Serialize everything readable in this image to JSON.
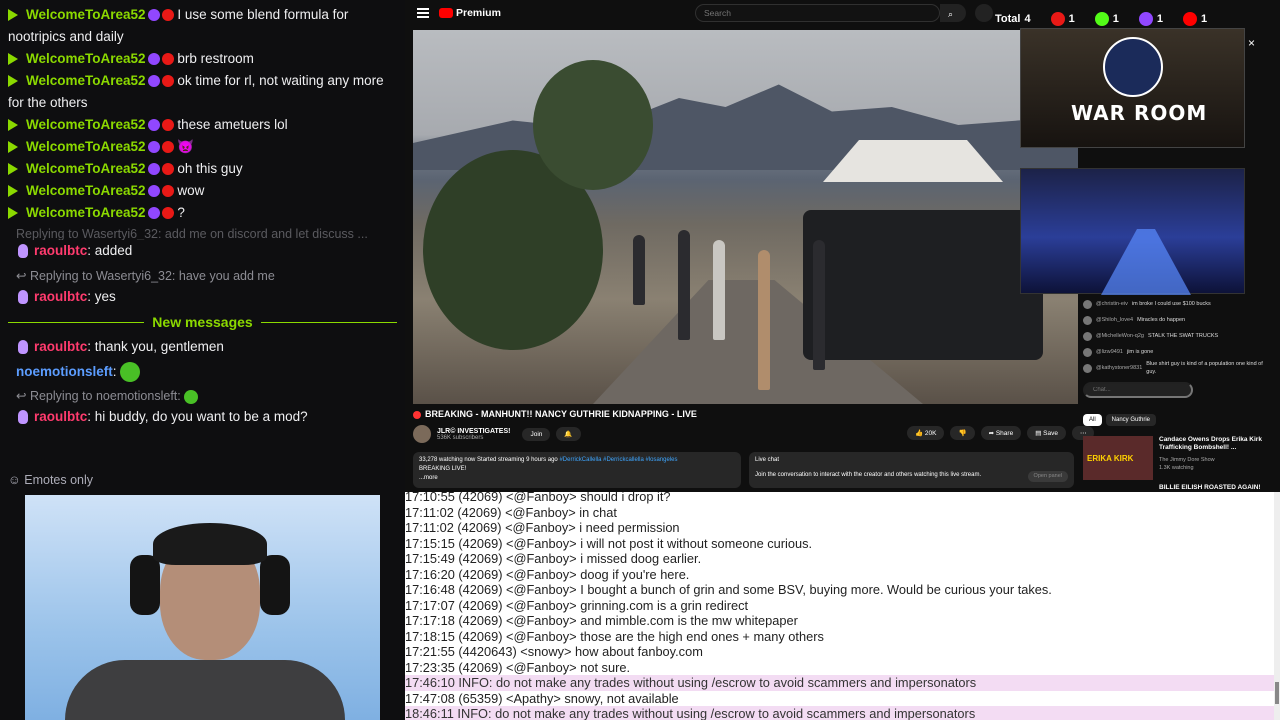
{
  "chat": {
    "messages": [
      {
        "user": "WelcomeToArea52",
        "text": "I use some blend formula for nootripics and daily"
      },
      {
        "user": "WelcomeToArea52",
        "text": "brb restroom"
      },
      {
        "user": "WelcomeToArea52",
        "text": "ok time for rl, not waiting any more for the others"
      },
      {
        "user": "WelcomeToArea52",
        "text": "these ametuers lol"
      },
      {
        "user": "WelcomeToArea52",
        "text": "👿"
      },
      {
        "user": "WelcomeToArea52",
        "text": "oh this guy"
      },
      {
        "user": "WelcomeToArea52",
        "text": "wow"
      },
      {
        "user": "WelcomeToArea52",
        "text": "?"
      }
    ],
    "reply1": "Replying to Wasertyi6_32: add me on discord and let discuss ...",
    "raoul1_user": "raoulbtc",
    "raoul1_text": ": added",
    "reply2": "Replying to Wasertyi6_32: have you add me",
    "raoul2_user": "raoulbtc",
    "raoul2_text": ": yes",
    "new_messages": "New messages",
    "raoul3_user": "raoulbtc",
    "raoul3_text": ": thank you, gentlemen",
    "noe_user": "noemotionsleft",
    "noe_text": ":",
    "reply3": "Replying to noemotionsleft:",
    "raoul4_user": "raoulbtc",
    "raoul4_text": ": hi buddy, do you want to be a mod?",
    "emotes_only": "Emotes only"
  },
  "youtube": {
    "logo": "Premium",
    "search_placeholder": "Search",
    "counter": {
      "total_label": "Total",
      "total_value": "4",
      "items": [
        {
          "value": "1",
          "color": "#e91916"
        },
        {
          "value": "1",
          "color": "#53fc18"
        },
        {
          "value": "1",
          "color": "#9147ff"
        },
        {
          "value": "1",
          "color": "#ff0000"
        }
      ]
    },
    "video_title": "BREAKING - MANHUNT!! NANCY GUTHRIE KIDNAPPING - LIVE",
    "channel_name": "JLR© INVESTIGATES!",
    "subscribers": "536K subscribers",
    "join": "Join",
    "likes": "20K",
    "share": "Share",
    "save": "Save",
    "desc_stats": "33,278 watching now  Started streaming 9 hours ago",
    "desc_tags": "#DerrickCallella #Derrickcallella #losangeles",
    "desc_line2": "BREAKING LIVE!",
    "desc_more": "...more",
    "livechat_title": "Live chat",
    "livechat_text": "Join the conversation to interact with the creator and others watching this live stream.",
    "livechat_open": "Open panel",
    "war_room": "WAR ROOM",
    "close": "×",
    "side_chat": [
      {
        "user": "@christin-eiv",
        "text": "im broke I could use $100 bucks"
      },
      {
        "user": "@Shiloh_love4",
        "text": "Miracles do happen"
      },
      {
        "user": "@MichelleWon-q2g",
        "text": "STALK THE SWAT TRUCKS"
      },
      {
        "user": "@lizw9491",
        "text": "jim is gone"
      },
      {
        "user": "@kathystoner9831",
        "text": "Blue shirt guy is kind of a population one kind of guy."
      }
    ],
    "chat_placeholder": "Chat...",
    "filters": [
      "All",
      "Nancy Guthrie"
    ],
    "rec_thumb_text": "ERIKA KIRK",
    "rec_title": "Candace Owens Drops Erika Kirk Trafficking Bombshell! ...",
    "rec_channel": "The Jimmy Dore Show",
    "rec_views": "1.3K watching",
    "rec2_title": "BILLIE EILISH ROASTED AGAIN!"
  },
  "irc": {
    "lines": [
      {
        "text": "17:10:55 (42069) <@Fanboy> should i drop it?",
        "info": false
      },
      {
        "text": "17:11:02 (42069) <@Fanboy> in chat",
        "info": false
      },
      {
        "text": "17:11:02 (42069) <@Fanboy> i need permission",
        "info": false
      },
      {
        "text": "17:15:15 (42069) <@Fanboy> i will not post it without someone curious.",
        "info": false
      },
      {
        "text": "17:15:49 (42069) <@Fanboy> i missed doog earlier.",
        "info": false
      },
      {
        "text": "17:16:20 (42069) <@Fanboy> doog if you're here.",
        "info": false
      },
      {
        "text": "17:16:48 (42069) <@Fanboy> I bought a bunch of grin and some BSV, buying more. Would be curious your takes.",
        "info": false
      },
      {
        "text": "17:17:07 (42069) <@Fanboy> grinning.com is a grin redirect",
        "info": false
      },
      {
        "text": "17:17:18 (42069) <@Fanboy> and mimble.com is the mw whitepaper",
        "info": false
      },
      {
        "text": "17:18:15 (42069) <@Fanboy> those are the high end ones + many others",
        "info": false
      },
      {
        "text": "17:21:55 (4420643) <snowy> how about fanboy.com",
        "info": false
      },
      {
        "text": "17:23:35 (42069) <@Fanboy> not sure.",
        "info": false
      },
      {
        "text": "17:46:10 INFO: do not make any trades without using /escrow to avoid scammers and impersonators",
        "info": true
      },
      {
        "text": "17:47:08 (65359) <Apathy> snowy, not available",
        "info": false
      },
      {
        "text": "18:46:11 INFO: do not make any trades without using /escrow to avoid scammers and impersonators",
        "info": true
      }
    ]
  }
}
